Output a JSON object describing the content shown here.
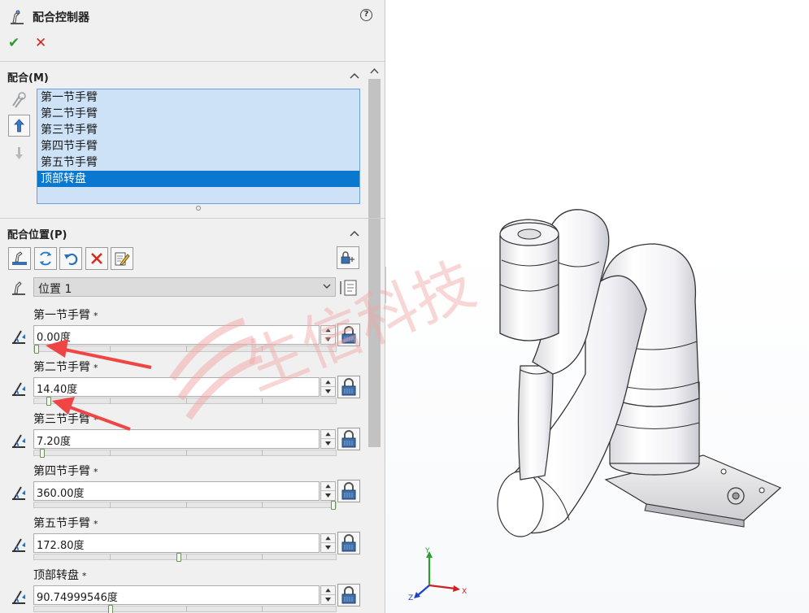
{
  "panel": {
    "title": "配合控制器",
    "help_label": "?",
    "ok_symbol": "✔",
    "cancel_symbol": "✕"
  },
  "mates_section": {
    "title": "配合(M)",
    "items": [
      "第一节手臂",
      "第二节手臂",
      "第三节手臂",
      "第四节手臂",
      "第五节手臂",
      "顶部转盘"
    ],
    "selected_index": 5
  },
  "position_section": {
    "title": "配合位置(P)",
    "position_name": "位置 1"
  },
  "joints": [
    {
      "label": "第一节手臂",
      "required_mark": "*",
      "value": "0.00度",
      "slider_fraction": 0.0
    },
    {
      "label": "第二节手臂",
      "required_mark": "*",
      "value": "14.40度",
      "slider_fraction": 0.04
    },
    {
      "label": "第三节手臂",
      "required_mark": "*",
      "value": "7.20度",
      "slider_fraction": 0.02
    },
    {
      "label": "第四节手臂",
      "required_mark": "*",
      "value": "360.00度",
      "slider_fraction": 1.0
    },
    {
      "label": "第五节手臂",
      "required_mark": "*",
      "value": "172.80度",
      "slider_fraction": 0.48
    },
    {
      "label": "顶部转盘",
      "required_mark": "*",
      "value": "90.74999546度",
      "slider_fraction": 0.25
    }
  ],
  "triad": {
    "x_label": "X",
    "y_label": "Y",
    "z_label": "Z"
  },
  "watermark": {
    "text": "生信科技"
  },
  "colors": {
    "list_bg": "#cde2f7",
    "selection": "#0b78d0",
    "ok": "#2e9c2e",
    "cancel": "#d0281e",
    "arrow": "#f04545",
    "watermark": "#f2a6a6"
  }
}
